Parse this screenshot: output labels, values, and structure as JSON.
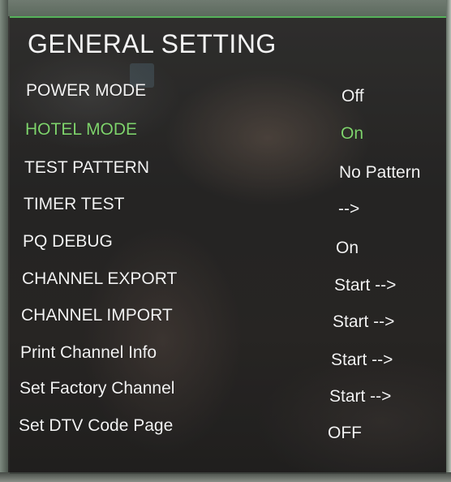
{
  "menu": {
    "title": "GENERAL SETTING",
    "items": [
      {
        "label": "POWER MODE",
        "value": "Off",
        "selected": false
      },
      {
        "label": "HOTEL MODE",
        "value": "On",
        "selected": true
      },
      {
        "label": "TEST PATTERN",
        "value": "No Pattern",
        "selected": false
      },
      {
        "label": "TIMER TEST",
        "value": "-->",
        "selected": false
      },
      {
        "label": "PQ DEBUG",
        "value": "On",
        "selected": false
      },
      {
        "label": "CHANNEL EXPORT",
        "value": "Start -->",
        "selected": false
      },
      {
        "label": "CHANNEL IMPORT",
        "value": "Start -->",
        "selected": false
      },
      {
        "label": "Print Channel Info",
        "value": "Start -->",
        "selected": false
      },
      {
        "label": "Set Factory Channel",
        "value": "Start -->",
        "selected": false
      },
      {
        "label": "Set DTV Code Page",
        "value": "OFF",
        "selected": false
      }
    ]
  },
  "colors": {
    "selected_text": "#7fd36d",
    "normal_text": "#f2f2f2",
    "accent_border": "#55b25a"
  }
}
